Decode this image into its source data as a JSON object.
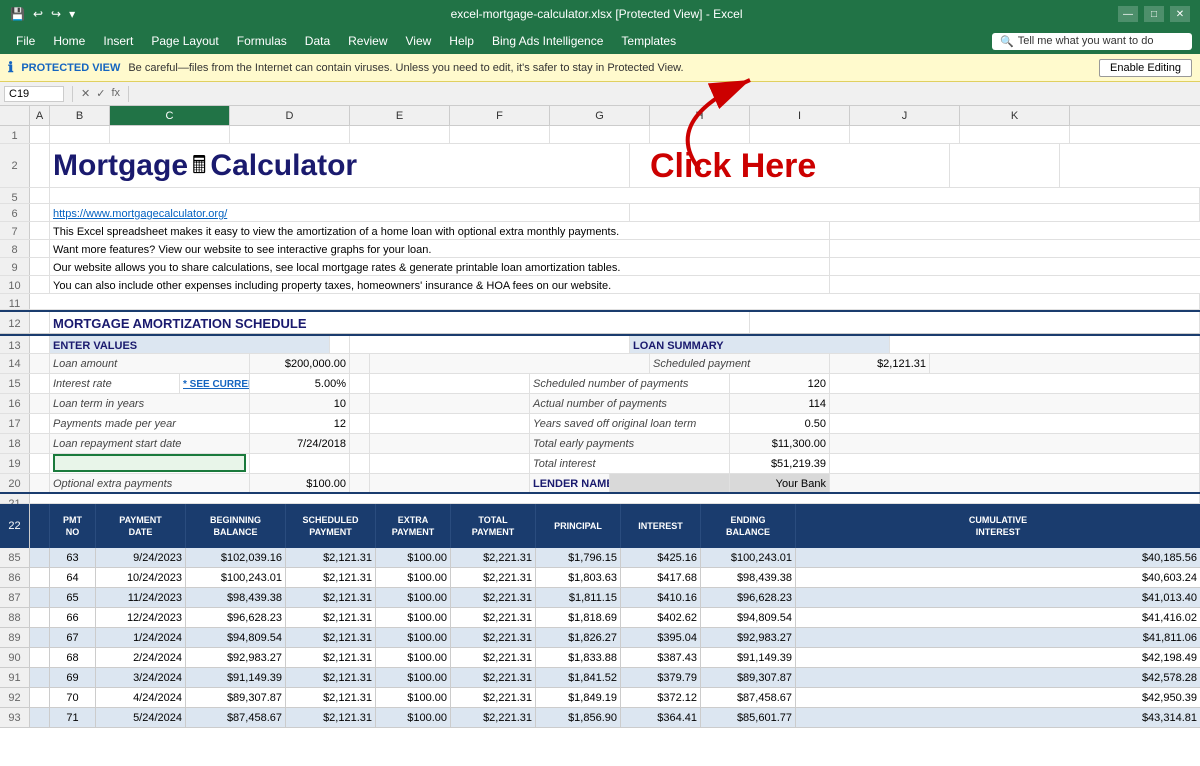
{
  "titlebar": {
    "filename": "excel-mortgage-calculator.xlsx [Protected View] - Excel",
    "save_icon": "💾",
    "undo_icon": "↩",
    "redo_icon": "↪"
  },
  "menubar": {
    "items": [
      "File",
      "Home",
      "Insert",
      "Page Layout",
      "Formulas",
      "Data",
      "Review",
      "View",
      "Help",
      "Bing Ads Intelligence",
      "Templates"
    ],
    "search_placeholder": "Tell me what you want to do"
  },
  "protected_bar": {
    "icon": "ℹ",
    "label": "PROTECTED VIEW",
    "message": "Be careful—files from the Internet can contain viruses. Unless you need to edit, it's safer to stay in Protected View.",
    "enable_btn": "Enable Editing"
  },
  "formula_bar": {
    "cell_ref": "C19",
    "formula": ""
  },
  "columns": {
    "headers": [
      "A",
      "B",
      "C",
      "D",
      "E",
      "F",
      "G",
      "H",
      "I",
      "J",
      "K"
    ],
    "active": "C"
  },
  "content": {
    "title": "Mortgage",
    "title2": "Calculator",
    "click_here": "Click Here",
    "url": "https://www.mortgagecalculator.org/",
    "description_lines": [
      "This Excel spreadsheet makes it easy to view the amortization of a home loan with optional extra monthly payments.",
      "Want more features? View our website to see interactive graphs for your loan.",
      "Our website allows you to share calculations, see local mortgage rates & generate printable loan amortization tables.",
      "You can also include other expenses including property taxes, homeowners' insurance & HOA fees on our website."
    ],
    "section_title": "MORTGAGE AMORTIZATION SCHEDULE",
    "enter_values_header": "ENTER VALUES",
    "loan_summary_header": "LOAN SUMMARY",
    "enter_values": [
      {
        "label": "Loan amount",
        "value": "$200,000.00"
      },
      {
        "label": "Interest rate",
        "value": "5.00%",
        "see_current": "* SEE CURRENT *"
      },
      {
        "label": "Loan term in years",
        "value": "10"
      },
      {
        "label": "Payments made per year",
        "value": "12"
      },
      {
        "label": "Loan repayment start date",
        "value": "7/24/2018"
      },
      {
        "label": "",
        "value": ""
      },
      {
        "label": "Optional extra payments",
        "value": "$100.00"
      }
    ],
    "loan_summary": [
      {
        "label": "Scheduled payment",
        "value": "$2,121.31"
      },
      {
        "label": "Scheduled number of payments",
        "value": "120"
      },
      {
        "label": "Actual number of payments",
        "value": "114"
      },
      {
        "label": "Years saved off original loan term",
        "value": "0.50"
      },
      {
        "label": "Total early payments",
        "value": "$11,300.00"
      },
      {
        "label": "Total interest",
        "value": "$51,219.39"
      }
    ],
    "lender_label": "LENDER NAME",
    "lender_value": "Your Bank",
    "table_headers": [
      "PMT NO",
      "PAYMENT DATE",
      "BEGINNING BALANCE",
      "SCHEDULED PAYMENT",
      "EXTRA PAYMENT",
      "TOTAL PAYMENT",
      "PRINCIPAL",
      "INTEREST",
      "ENDING BALANCE",
      "CUMULATIVE INTEREST"
    ],
    "table_rows": [
      {
        "pmt": "63",
        "date": "9/24/2023",
        "beg_bal": "$102,039.16",
        "sched": "$2,121.31",
        "extra": "$100.00",
        "total": "$2,221.31",
        "principal": "$1,796.15",
        "interest": "$425.16",
        "end_bal": "$100,243.01",
        "cum_int": "$40,185.56",
        "even": true
      },
      {
        "pmt": "64",
        "date": "10/24/2023",
        "beg_bal": "$100,243.01",
        "sched": "$2,121.31",
        "extra": "$100.00",
        "total": "$2,221.31",
        "principal": "$1,803.63",
        "interest": "$417.68",
        "end_bal": "$98,439.38",
        "cum_int": "$40,603.24",
        "even": false
      },
      {
        "pmt": "65",
        "date": "11/24/2023",
        "beg_bal": "$98,439.38",
        "sched": "$2,121.31",
        "extra": "$100.00",
        "total": "$2,221.31",
        "principal": "$1,811.15",
        "interest": "$410.16",
        "end_bal": "$96,628.23",
        "cum_int": "$41,013.40",
        "even": true
      },
      {
        "pmt": "66",
        "date": "12/24/2023",
        "beg_bal": "$96,628.23",
        "sched": "$2,121.31",
        "extra": "$100.00",
        "total": "$2,221.31",
        "principal": "$1,818.69",
        "interest": "$402.62",
        "end_bal": "$94,809.54",
        "cum_int": "$41,416.02",
        "even": false
      },
      {
        "pmt": "67",
        "date": "1/24/2024",
        "beg_bal": "$94,809.54",
        "sched": "$2,121.31",
        "extra": "$100.00",
        "total": "$2,221.31",
        "principal": "$1,826.27",
        "interest": "$395.04",
        "end_bal": "$92,983.27",
        "cum_int": "$41,811.06",
        "even": true
      },
      {
        "pmt": "68",
        "date": "2/24/2024",
        "beg_bal": "$92,983.27",
        "sched": "$2,121.31",
        "extra": "$100.00",
        "total": "$2,221.31",
        "principal": "$1,833.88",
        "interest": "$387.43",
        "end_bal": "$91,149.39",
        "cum_int": "$42,198.49",
        "even": false
      },
      {
        "pmt": "69",
        "date": "3/24/2024",
        "beg_bal": "$91,149.39",
        "sched": "$2,121.31",
        "extra": "$100.00",
        "total": "$2,221.31",
        "principal": "$1,841.52",
        "interest": "$379.79",
        "end_bal": "$89,307.87",
        "cum_int": "$42,578.28",
        "even": true
      },
      {
        "pmt": "70",
        "date": "4/24/2024",
        "beg_bal": "$89,307.87",
        "sched": "$2,121.31",
        "extra": "$100.00",
        "total": "$2,221.31",
        "principal": "$1,849.19",
        "interest": "$372.12",
        "end_bal": "$87,458.67",
        "cum_int": "$42,950.39",
        "even": false
      },
      {
        "pmt": "71",
        "date": "5/24/2024",
        "beg_bal": "$87,458.67",
        "sched": "$2,121.31",
        "extra": "$100.00",
        "total": "$2,221.31",
        "principal": "$1,856.90",
        "interest": "$364.41",
        "end_bal": "$85,601.77",
        "cum_int": "$43,314.81",
        "even": true
      }
    ],
    "row_numbers": [
      "85",
      "86",
      "87",
      "88",
      "89",
      "90",
      "91",
      "92",
      "93"
    ]
  }
}
